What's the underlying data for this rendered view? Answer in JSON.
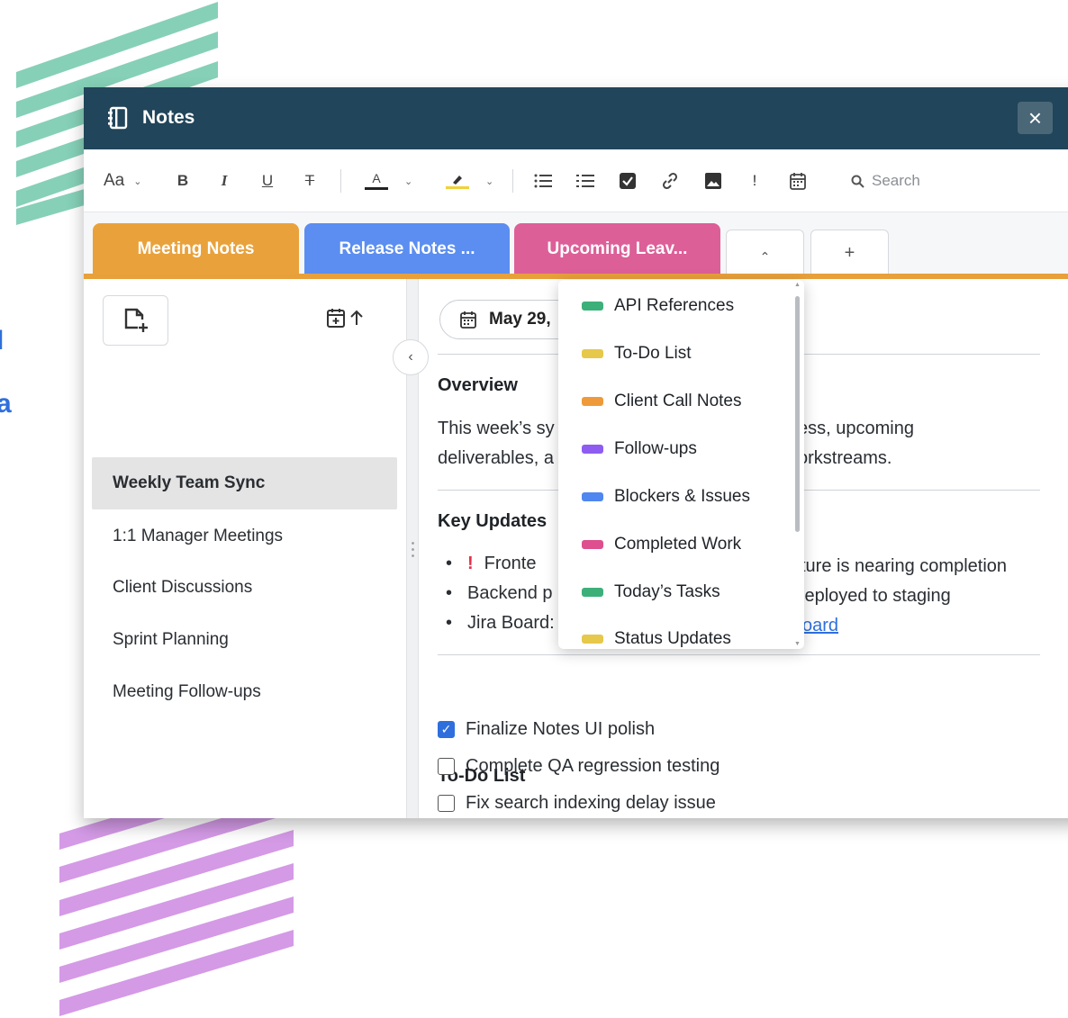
{
  "window": {
    "title": "Notes",
    "close_label": "×"
  },
  "edge_letters": [
    "l",
    "a"
  ],
  "toolbar": {
    "font_size_label": "Aa",
    "bold": "B",
    "italic": "I",
    "underline": "U",
    "strike": "T",
    "font_color": "A",
    "bang": "!",
    "search_placeholder": "Search"
  },
  "tabs": [
    {
      "label": "Meeting Notes",
      "color": "#e9a23b"
    },
    {
      "label": "Release Notes ...",
      "color": "#5b8ef0"
    },
    {
      "label": "Upcoming Leav...",
      "color": "#dd5f98"
    }
  ],
  "tab_controls": {
    "collapse": "⌃",
    "add": "+"
  },
  "sidebar": {
    "items": [
      {
        "label": "Weekly Team Sync",
        "active": true
      },
      {
        "label": "1:1 Manager Meetings"
      },
      {
        "label": "Client Discussions"
      },
      {
        "label": "Sprint Planning"
      },
      {
        "label": "Meeting Follow-ups"
      }
    ]
  },
  "note": {
    "date": "May 29,",
    "overview_heading": "Overview",
    "overview_line1_a": "This week’s sy",
    "overview_line1_b": "ess, upcoming",
    "overview_line2_a": "deliverables, a",
    "overview_line2_b": "orkstreams.",
    "key_updates_heading": "Key Updates",
    "bullets": [
      {
        "a": "Fronte",
        "b": "ture is nearing completion"
      },
      {
        "a": "Backend p",
        "b": "leployed to staging"
      },
      {
        "a": "Jira Board:",
        "link": "oard"
      }
    ],
    "todo_heading": "To-Do List",
    "todos": [
      {
        "label": "Finalize Notes UI polish",
        "checked": true
      },
      {
        "label": "Complete QA regression testing",
        "checked": false
      },
      {
        "label": "Fix search indexing delay issue",
        "checked": false
      }
    ]
  },
  "template_menu": {
    "items": [
      {
        "label": "API References",
        "color": "#3db07a"
      },
      {
        "label": "To-Do List",
        "color": "#e6c84a"
      },
      {
        "label": "Client Call Notes",
        "color": "#ee9a3a"
      },
      {
        "label": "Follow-ups",
        "color": "#8e5cf0"
      },
      {
        "label": "Blockers & Issues",
        "color": "#4f86ef"
      },
      {
        "label": "Completed Work",
        "color": "#dd4f8f"
      },
      {
        "label": "Today’s Tasks",
        "color": "#3db07a"
      },
      {
        "label": "Status Updates",
        "color": "#e6c84a"
      }
    ]
  }
}
